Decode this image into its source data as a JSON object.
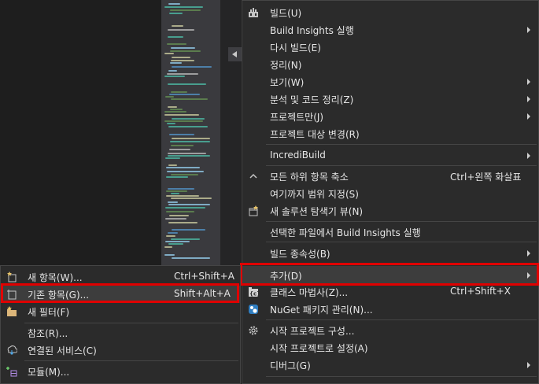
{
  "main_menu": {
    "items": [
      {
        "label": "빌드(U)",
        "icon": "build-icon"
      },
      {
        "label": "Build Insights 실행",
        "submenu": true
      },
      {
        "label": "다시 빌드(E)"
      },
      {
        "label": "정리(N)"
      },
      {
        "label": "보기(W)",
        "submenu": true
      },
      {
        "label": "분석 및 코드 정리(Z)",
        "submenu": true
      },
      {
        "label": "프로젝트만(J)",
        "submenu": true
      },
      {
        "label": "프로젝트 대상 변경(R)"
      },
      {
        "label": "IncrediBuild",
        "submenu": true
      },
      {
        "label": "모든 하위 항목 축소",
        "shortcut": "Ctrl+왼쪽 화살표",
        "icon": "collapse-icon"
      },
      {
        "label": "여기까지 범위 지정(S)"
      },
      {
        "label": "새 솔루션 탐색기 뷰(N)",
        "icon": "new-view-icon"
      },
      {
        "label": "선택한 파일에서 Build Insights 실행"
      },
      {
        "label": "빌드 종속성(B)",
        "submenu": true
      },
      {
        "label": "추가(D)",
        "submenu": true
      },
      {
        "label": "클래스 마법사(Z)...",
        "shortcut": "Ctrl+Shift+X",
        "icon": "class-wizard-icon"
      },
      {
        "label": "NuGet 패키지 관리(N)...",
        "icon": "nuget-icon"
      },
      {
        "label": "시작 프로젝트 구성...",
        "icon": "gear-icon"
      },
      {
        "label": "시작 프로젝트로 설정(A)"
      },
      {
        "label": "디버그(G)",
        "submenu": true
      }
    ]
  },
  "sub_menu": {
    "items": [
      {
        "label": "새 항목(W)...",
        "shortcut": "Ctrl+Shift+A",
        "icon": "new-item-icon"
      },
      {
        "label": "기존 항목(G)...",
        "shortcut": "Shift+Alt+A",
        "icon": "existing-item-icon"
      },
      {
        "label": "새 필터(F)",
        "icon": "new-filter-icon"
      },
      {
        "label": "참조(R)..."
      },
      {
        "label": "연결된 서비스(C)",
        "icon": "connected-service-icon"
      },
      {
        "label": "모듈(M)...",
        "icon": "module-icon"
      }
    ]
  },
  "colors": {
    "highlight_border": "#e00000",
    "menu_bg": "#2b2b2b",
    "hover_bg": "#3d3d3d"
  }
}
